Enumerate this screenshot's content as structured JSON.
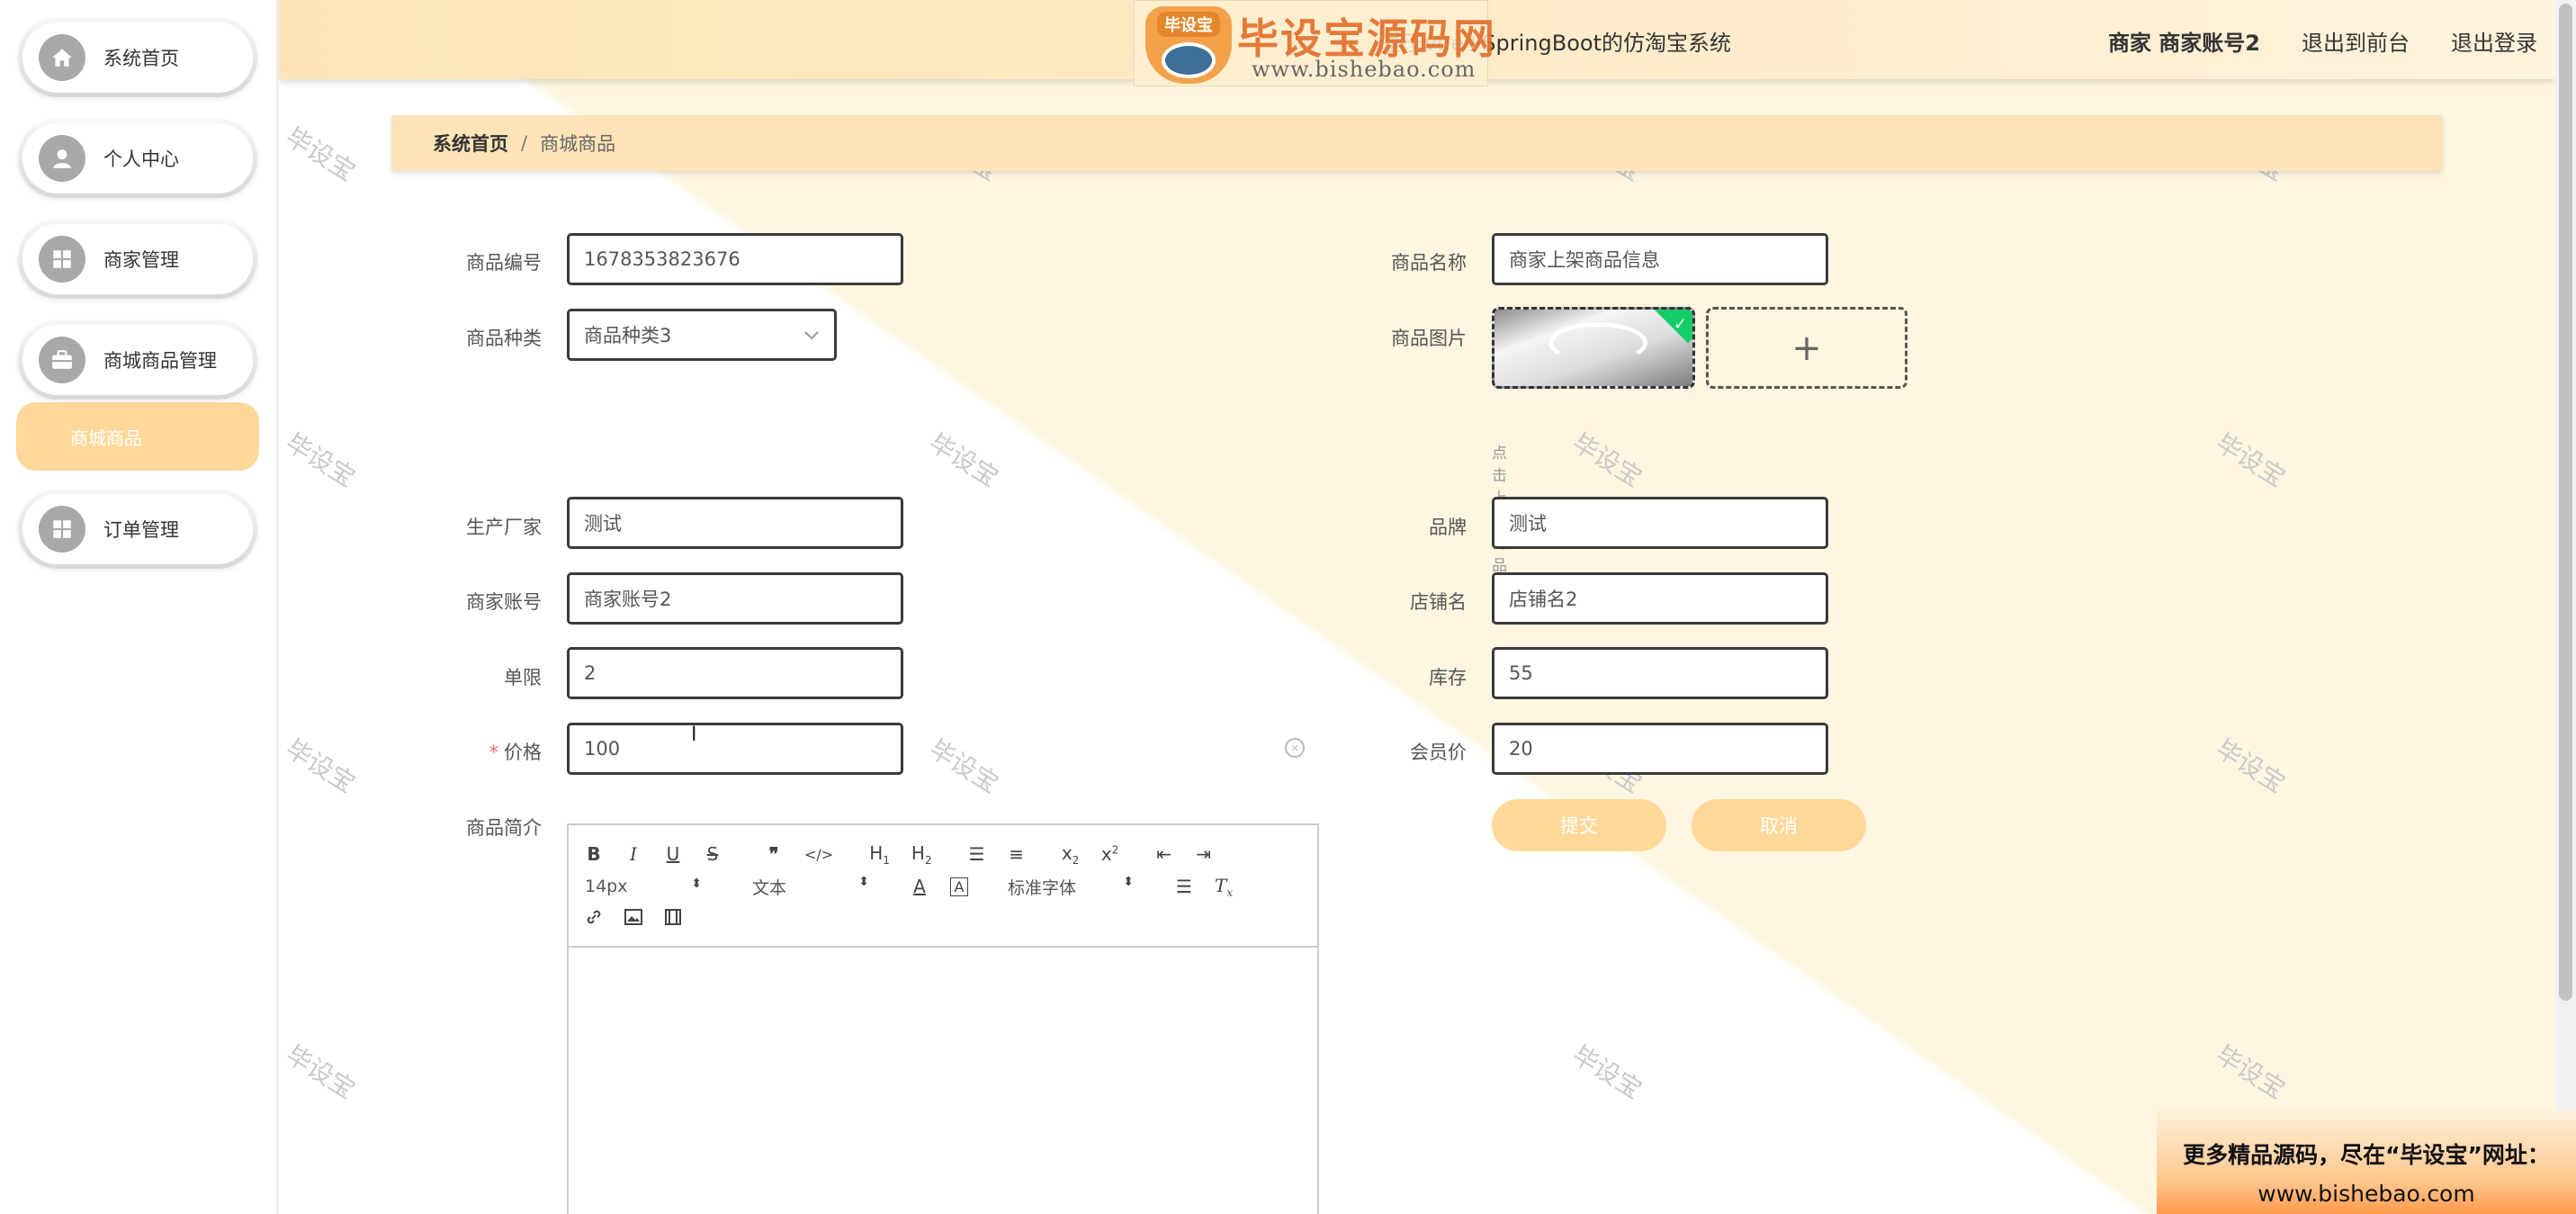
{
  "header": {
    "title": "基于vue+SpringBoot的仿淘宝系统",
    "user_label": "商家 商家账号2",
    "to_front_label": "退出到前台",
    "logout_label": "退出登录"
  },
  "logo": {
    "badge_text": "毕设宝",
    "cn_text": "毕设宝源码网",
    "url_text": "www.bishebao.com"
  },
  "sidebar": {
    "items": [
      {
        "label": "系统首页",
        "icon": "home-icon"
      },
      {
        "label": "个人中心",
        "icon": "user-icon"
      },
      {
        "label": "商家管理",
        "icon": "grid-icon"
      },
      {
        "label": "商城商品管理",
        "icon": "briefcase-icon"
      },
      {
        "label": "订单管理",
        "icon": "grid-icon"
      }
    ],
    "submenu_active": "商城商品"
  },
  "breadcrumb": {
    "home": "系统首页",
    "separator": "/",
    "current": "商城商品"
  },
  "form": {
    "product_code": {
      "label": "商品编号",
      "value": "1678353823676"
    },
    "product_name": {
      "label": "商品名称",
      "value": "商家上架商品信息"
    },
    "category": {
      "label": "商品种类",
      "value": "商品种类3"
    },
    "image": {
      "label": "商品图片",
      "hint": "点击上传商品图片"
    },
    "manufacturer": {
      "label": "生产厂家",
      "value": "测试"
    },
    "brand": {
      "label": "品牌",
      "value": "测试"
    },
    "merchant_account": {
      "label": "商家账号",
      "value": "商家账号2"
    },
    "shop_name": {
      "label": "店铺名",
      "value": "店铺名2"
    },
    "limit": {
      "label": "单限",
      "value": "2"
    },
    "stock": {
      "label": "库存",
      "value": "55"
    },
    "price": {
      "label": "价格",
      "required_mark": "*",
      "value": "100"
    },
    "member_price": {
      "label": "会员价",
      "value": "20"
    },
    "description": {
      "label": "商品简介"
    },
    "submit_label": "提交",
    "cancel_label": "取消"
  },
  "editor": {
    "font_size": "14px",
    "paragraph": "文本",
    "font_family": "标准字体"
  },
  "watermark": "毕设宝",
  "ad": {
    "line1": "更多精品源码，尽在“毕设宝”网址：",
    "line2": "www.bishebao.com"
  },
  "colors": {
    "accent": "#ffd99a",
    "header_bg": "#fde4b8",
    "upload_badge": "#13ce66",
    "required": "#f56c6c"
  }
}
